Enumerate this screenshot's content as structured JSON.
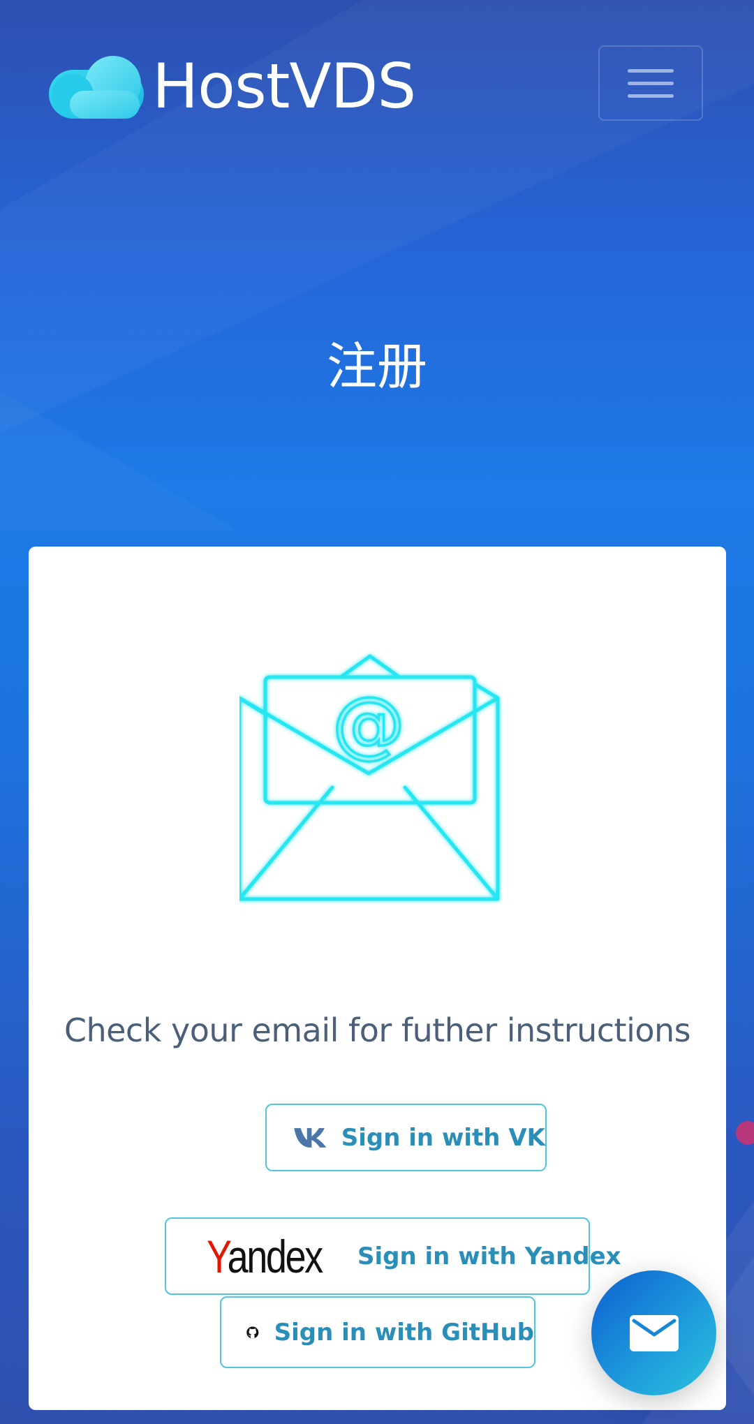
{
  "brand": {
    "name": "HostVDS",
    "logo_icon": "cloud-logo"
  },
  "header": {
    "menu_icon": "hamburger-menu-icon"
  },
  "page": {
    "title": "注册"
  },
  "card": {
    "illustration_icon": "open-envelope-email-icon",
    "message": "Check your email for futher instructions",
    "buttons": {
      "vk_label": "Sign in with VK",
      "yandex_logo_first": "Y",
      "yandex_logo_rest": "andex",
      "yandex_label": "Sign in with Yandex",
      "github_label": "Sign in with GitHub"
    }
  },
  "fab": {
    "icon": "mail-icon"
  },
  "colors": {
    "accent_cyan": "#27e6f2",
    "button_text": "#2a8fb8",
    "button_border": "#4fc6dc",
    "message_text": "#4b6078",
    "yandex_red": "#e61400"
  }
}
